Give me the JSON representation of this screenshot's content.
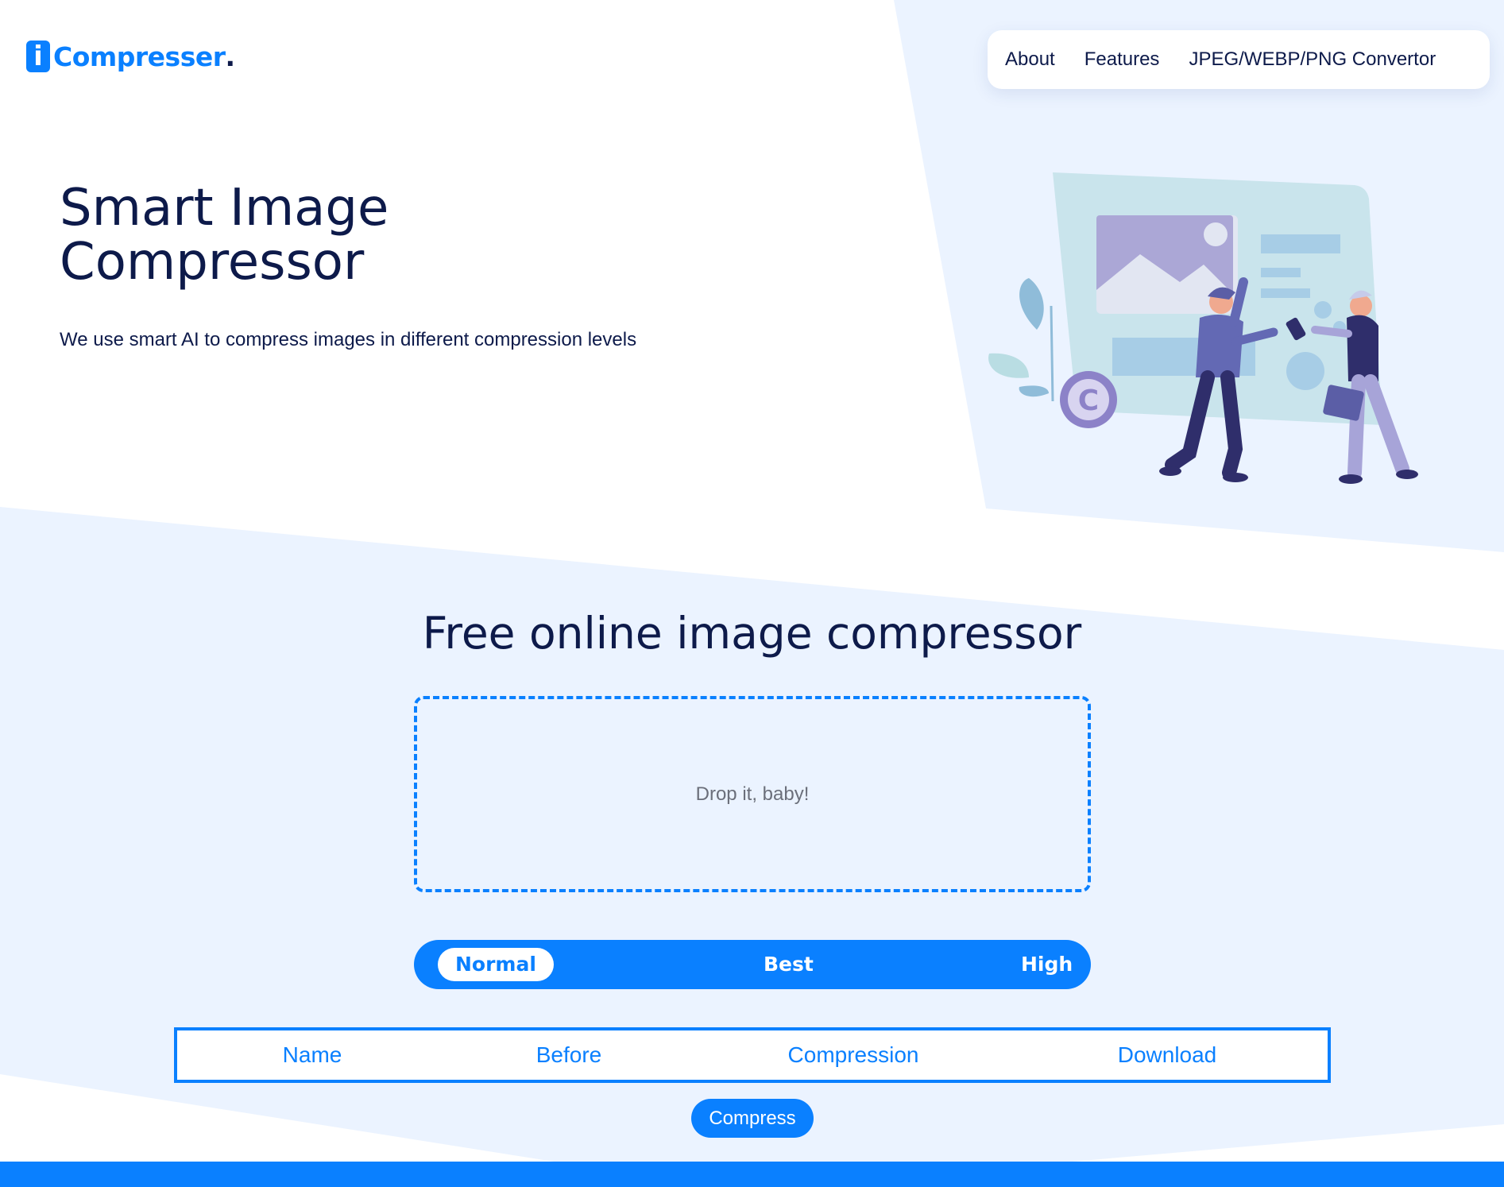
{
  "brand": {
    "logo_letter": "i",
    "name": "Compresser",
    "dot": "."
  },
  "nav": {
    "links": [
      "About",
      "Features",
      "JPEG/WEBP/PNG Convertor"
    ]
  },
  "hero": {
    "title_line1": "Smart Image",
    "title_line2": "Compressor",
    "subtitle": "We use smart AI to compress images in different compression levels",
    "illustration": "people-uploading-image-illustration",
    "badge_letter": "C"
  },
  "compressor": {
    "title": "Free online image compressor",
    "dropzone_text": "Drop it, baby!",
    "levels": [
      "Normal",
      "Best",
      "High"
    ],
    "selected_level": "Normal",
    "table_headers": [
      "Name",
      "Before",
      "Compression",
      "Download"
    ],
    "compress_label": "Compress"
  },
  "colors": {
    "accent": "#0a80ff",
    "navy": "#0d1a4a",
    "light_bg": "#ebf3ff"
  }
}
